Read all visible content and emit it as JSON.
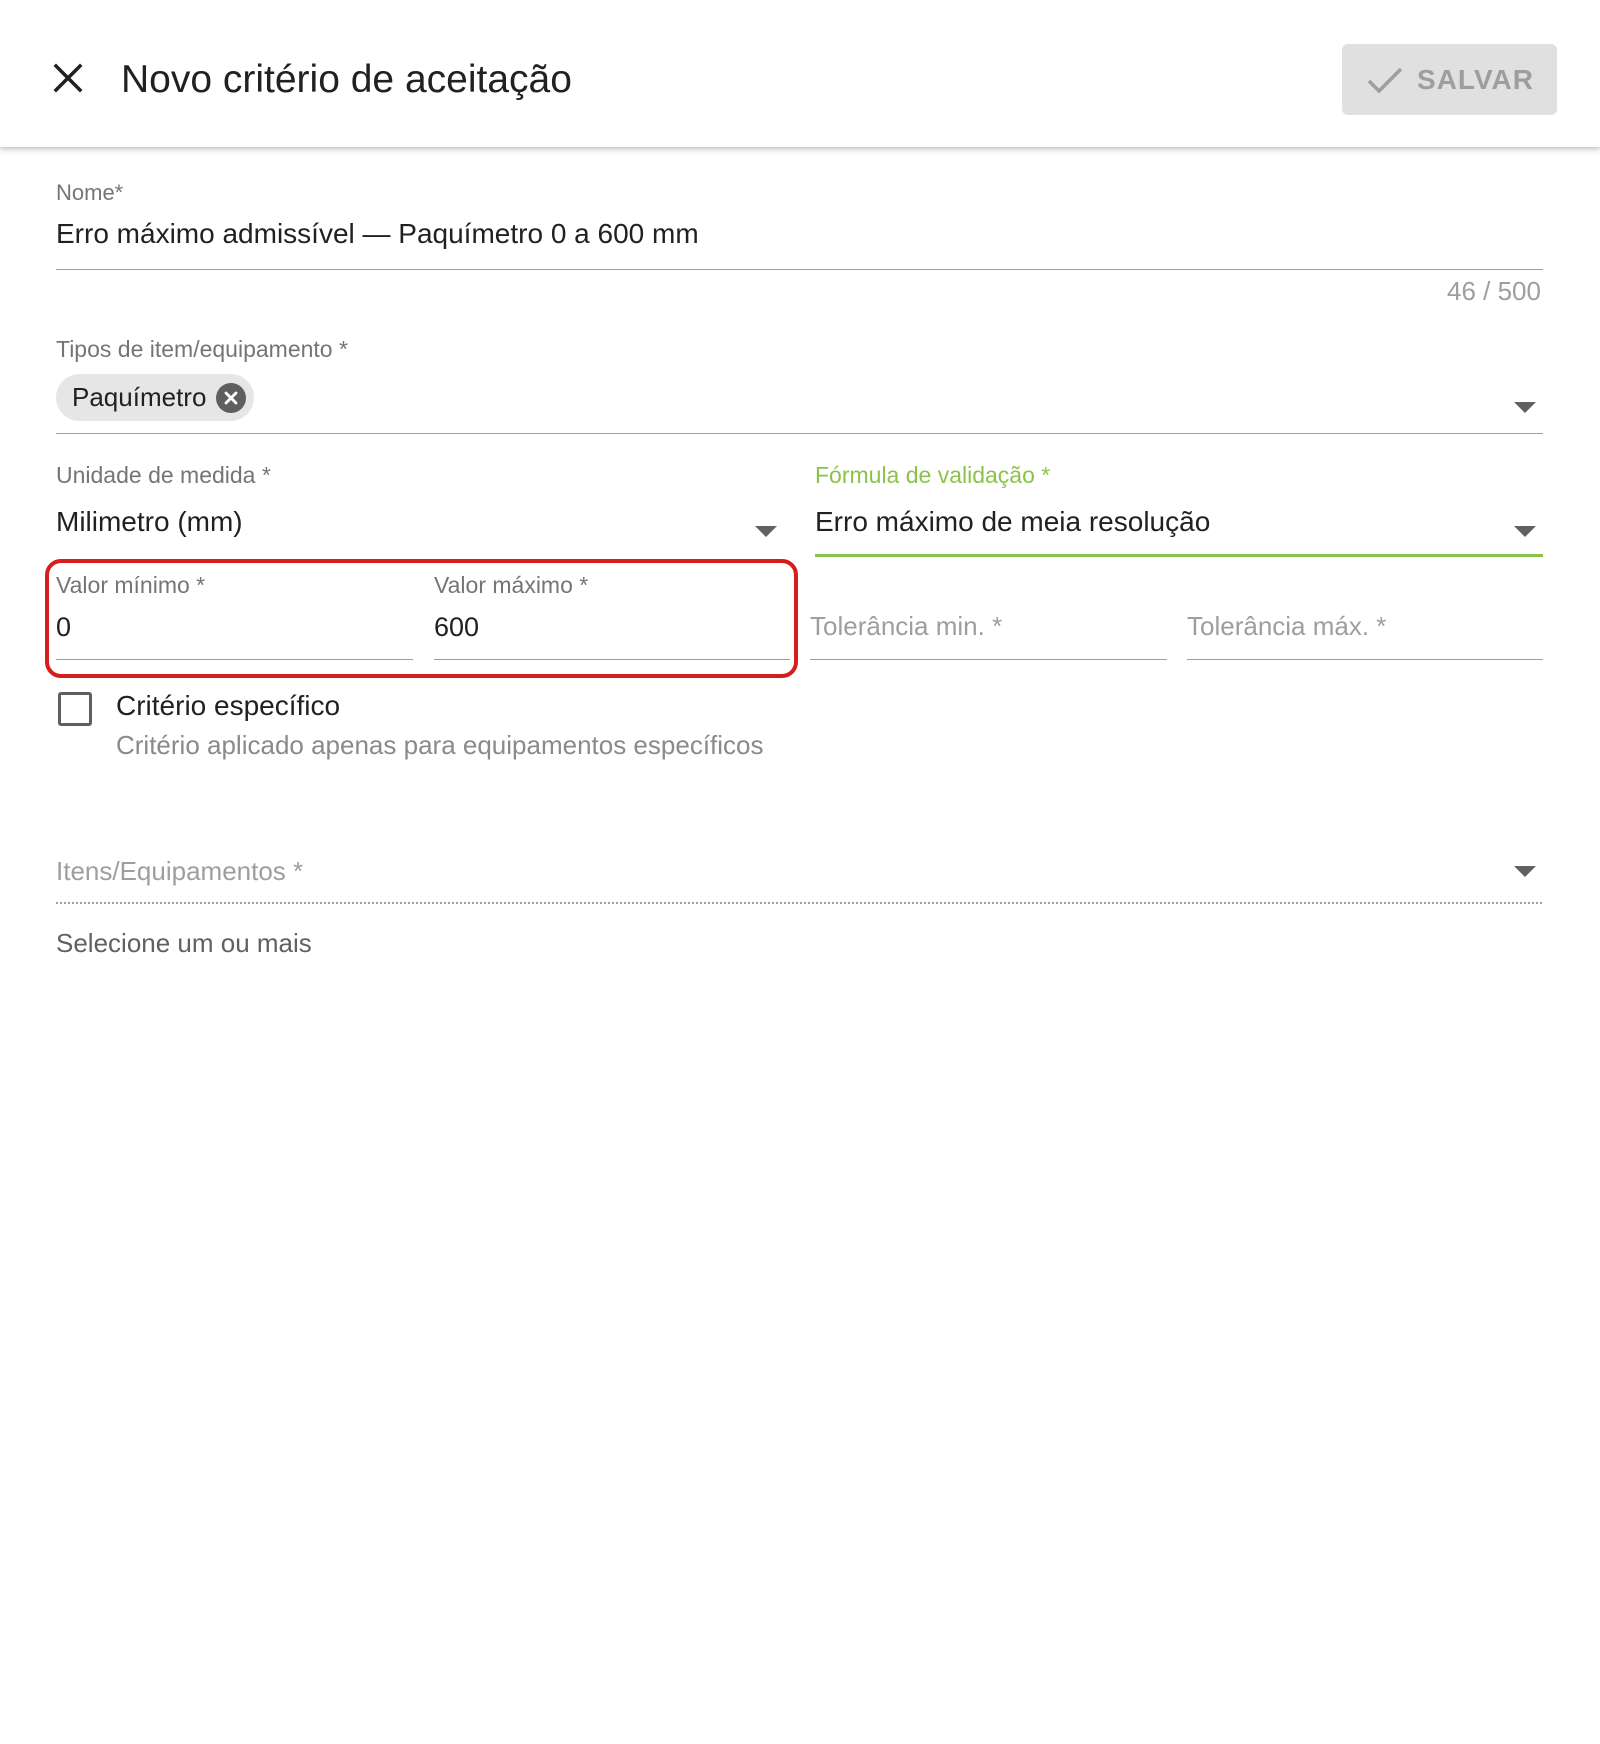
{
  "header": {
    "title": "Novo critério de aceitação",
    "save_label": "SALVAR"
  },
  "form": {
    "name": {
      "label": "Nome*",
      "value": "Erro máximo admissível — Paquímetro 0 a 600 mm",
      "counter": "46 / 500"
    },
    "item_types": {
      "label": "Tipos de item/equipamento *",
      "chips": [
        "Paquímetro"
      ]
    },
    "unit": {
      "label": "Unidade de medida *",
      "value": "Milimetro (mm)"
    },
    "formula": {
      "label": "Fórmula de validação *",
      "value": "Erro máximo de meia resolução",
      "accent_color": "#8bc34a"
    },
    "min_value": {
      "label": "Valor mínimo *",
      "value": "0"
    },
    "max_value": {
      "label": "Valor máximo *",
      "value": "600"
    },
    "tolerance_min": {
      "placeholder": "Tolerância min. *"
    },
    "tolerance_max": {
      "placeholder": "Tolerância máx. *"
    },
    "specific_criterion": {
      "label": "Critério específico",
      "hint": "Critério aplicado apenas para equipamentos específicos",
      "checked": false
    },
    "items": {
      "placeholder": "Itens/Equipamentos *",
      "hint": "Selecione um ou mais"
    }
  },
  "highlight_color": "#d81b1b",
  "icons": {
    "close": "close-icon",
    "save": "check-icon",
    "chip_remove": "cancel-circle-icon",
    "dropdown": "arrow-drop-down-icon"
  }
}
